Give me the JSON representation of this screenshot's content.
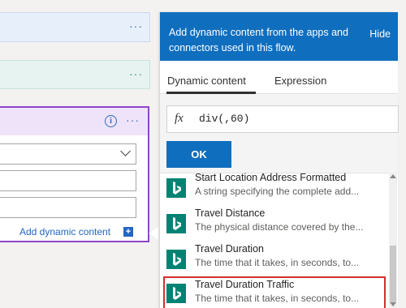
{
  "canvas": {
    "card": {
      "add_dynamic_label": "Add dynamic content",
      "add_icon": "+"
    }
  },
  "panel": {
    "header_text": "Add dynamic content from the apps and connectors used in this flow.",
    "hide_label": "Hide",
    "tabs": [
      {
        "label": "Dynamic content",
        "active": true
      },
      {
        "label": "Expression",
        "active": false
      }
    ],
    "expression": {
      "fx_label": "fx",
      "value": "div(,60)",
      "ok_label": "OK"
    },
    "items": [
      {
        "title": "Start Location Address Formatted",
        "desc": "A string specifying the complete add...",
        "icon": "bing-logo-icon"
      },
      {
        "title": "Travel Distance",
        "desc": "The physical distance covered by the...",
        "icon": "bing-logo-icon"
      },
      {
        "title": "Travel Duration",
        "desc": "The time that it takes, in seconds, to...",
        "icon": "bing-logo-icon"
      },
      {
        "title": "Travel Duration Traffic",
        "desc": "The time that it takes, in seconds, to...",
        "icon": "bing-logo-icon",
        "selected": true
      }
    ]
  },
  "colors": {
    "accent": "#106ebe",
    "card_border": "#8e44c8",
    "bing_green": "#008373",
    "selection": "#d32f2f"
  }
}
